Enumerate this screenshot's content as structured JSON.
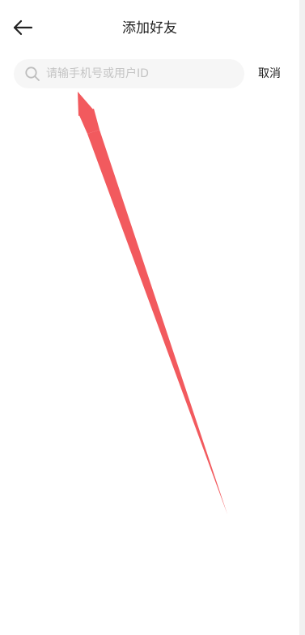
{
  "header": {
    "title": "添加好友",
    "back_icon": "arrow-left-icon"
  },
  "search": {
    "placeholder": "请输手机号或用户ID",
    "value": "",
    "icon": "search-icon",
    "cancel_label": "取消"
  },
  "colors": {
    "annotation_arrow": "#f25a5e",
    "search_background": "#f6f6f6",
    "placeholder_text": "#c4c4c4"
  }
}
